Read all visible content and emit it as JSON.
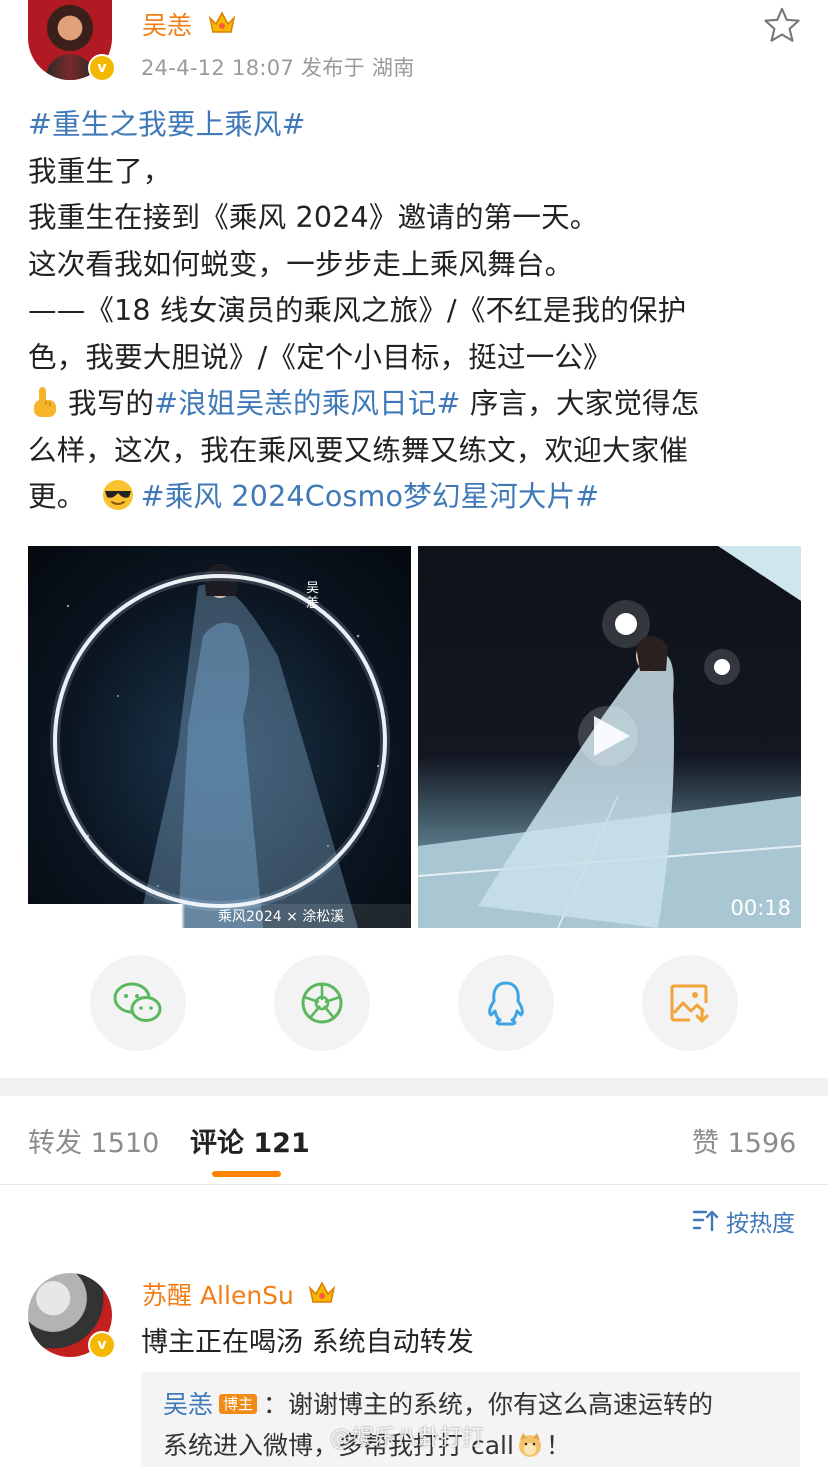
{
  "post": {
    "author": "吴恙",
    "meta": "24-4-12 18:07  发布于 湖南",
    "lines": [
      [
        "#重生之我要上乘风#"
      ],
      [
        "我重生了，"
      ],
      [
        "我重生在接到《乘风 2024》邀请的第一天。"
      ],
      [
        "这次看我如何蜕变，一步步走上乘风舞台。"
      ],
      [
        "——《18 线女演员的乘风之旅》/《不红是我的保护"
      ],
      [
        "色，我要大胆说》/《定个小目标，挺过一公》"
      ],
      [
        "我写的",
        "#浪姐吴恙的乘风日记#",
        " 序言，大家觉得怎"
      ],
      [
        "么样，这次，我在乘风要又练舞又练文，欢迎大家催"
      ],
      [
        "更。",
        "#乘风 2024Cosmo梦幻星河大片#"
      ]
    ],
    "image1_text": "吴恙",
    "image1_caption": "乘风2024 × 涂松溪",
    "video_duration": "00:18"
  },
  "share": {
    "icons": [
      "wechat-icon",
      "moments-icon",
      "qq-icon",
      "save-image-icon"
    ],
    "colors": {
      "wechat": "#5bb85f",
      "moments": "#5bb85f",
      "qq": "#3fa4e6",
      "save": "#f2a33a"
    }
  },
  "tabs": {
    "repost": "转发 1510",
    "comments": "评论 121",
    "likes": "赞 1596",
    "accent": "#ff8200"
  },
  "sort_label": "按热度",
  "comment": {
    "author": "苏醒 AllenSu",
    "text": "博主正在喝汤 系统自动转发",
    "reply_author": "吴恙",
    "reply_tag": "博主",
    "reply_line1": "：谢谢博主的系统，你有这么高速运转的",
    "reply_line2": "系统进入微博，多帮我打打 call",
    "reply_end": "！"
  },
  "watermark": "@娱乐八卦打打"
}
